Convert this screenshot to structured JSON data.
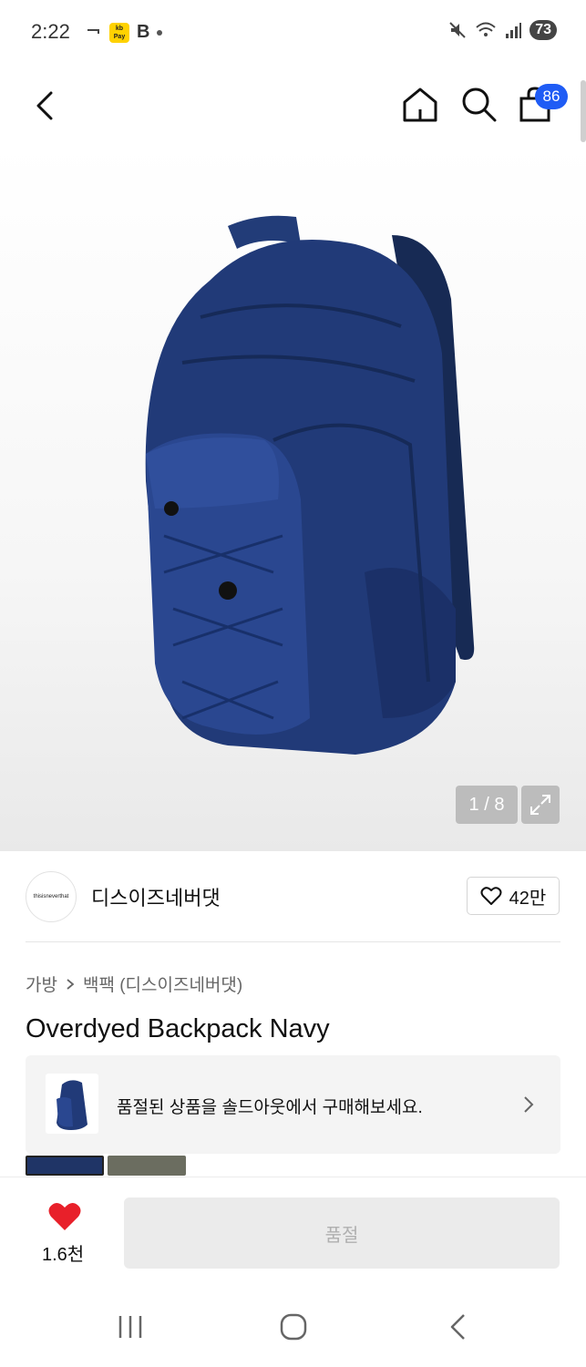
{
  "status_bar": {
    "time": "2:22",
    "pay_label": "kb\nPay",
    "b_label": "B",
    "battery": "73"
  },
  "nav": {
    "cart_badge": "86"
  },
  "gallery": {
    "counter": "1 / 8",
    "current_index": 1,
    "total": 8,
    "product_color": "#1f3466"
  },
  "brand": {
    "logo_text": "thisisneverthat",
    "name": "디스이즈네버댓",
    "like_count": "42만"
  },
  "breadcrumb": {
    "category": "가방",
    "subcategory": "백팩 (디스이즈네버댓)"
  },
  "product": {
    "title": "Overdyed Backpack Navy"
  },
  "sold_banner": {
    "text": "품절된 상품을 솔드아웃에서 구매해보세요."
  },
  "bottom": {
    "wish_count": "1.6천",
    "button_label": "품절",
    "heart_color": "#E8202A"
  }
}
